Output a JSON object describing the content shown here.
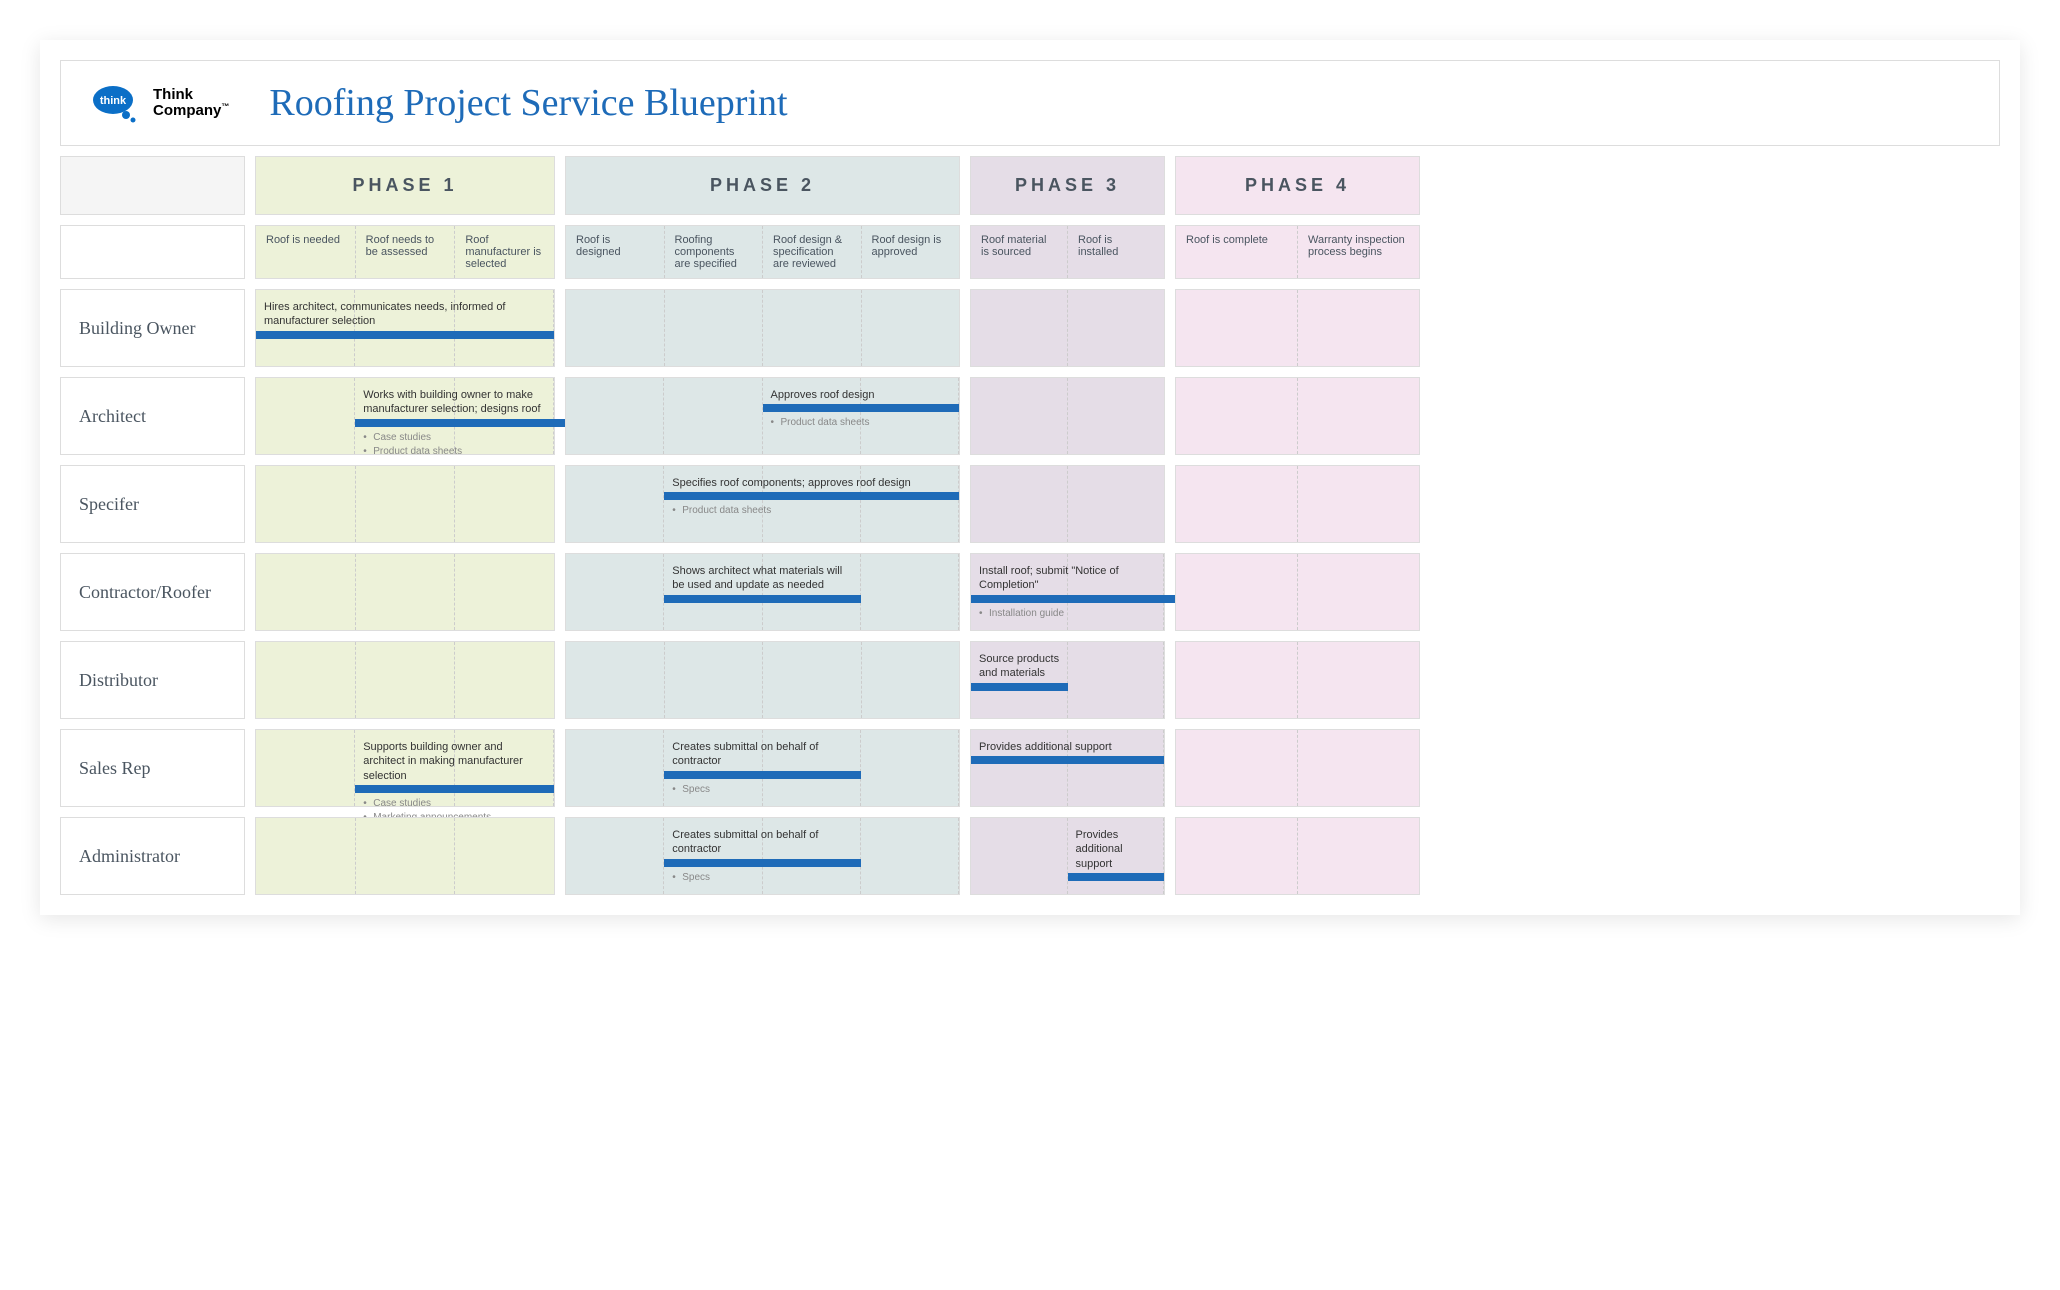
{
  "header": {
    "logo_text1": "Think",
    "logo_text2": "Company",
    "title": "Roofing Project Service Blueprint"
  },
  "phases": [
    {
      "id": "phase1",
      "label": "PHASE 1",
      "subs": [
        "Roof is needed",
        "Roof needs to be assessed",
        "Roof manufacturer is selected"
      ]
    },
    {
      "id": "phase2",
      "label": "PHASE 2",
      "subs": [
        "Roof is designed",
        "Roofing components are specified",
        "Roof design & specification are reviewed",
        "Roof design is approved"
      ]
    },
    {
      "id": "phase3",
      "label": "PHASE 3",
      "subs": [
        "Roof material is sourced",
        "Roof is installed"
      ]
    },
    {
      "id": "phase4",
      "label": "PHASE 4",
      "subs": [
        "Roof is complete",
        "Warranty inspection process begins"
      ]
    }
  ],
  "roles": [
    {
      "name": "Building Owner"
    },
    {
      "name": "Architect"
    },
    {
      "name": "Specifer"
    },
    {
      "name": "Contractor/Roofer"
    },
    {
      "name": "Distributor"
    },
    {
      "name": "Sales Rep"
    },
    {
      "name": "Administrator"
    }
  ],
  "tasks": {
    "building_owner_p1": {
      "text": "Hires architect, communicates needs, informed of manufacturer selection"
    },
    "architect_p1": {
      "text": "Works with building owner to make manufacturer selection; designs roof",
      "notes": [
        "Case studies",
        "Product data sheets"
      ]
    },
    "architect_p2": {
      "text": "Approves roof design",
      "notes": [
        "Product data sheets"
      ]
    },
    "specifier_p2": {
      "text": "Specifies roof components; approves roof design",
      "notes": [
        "Product data sheets"
      ]
    },
    "contractor_p2": {
      "text": "Shows architect what materials will be used and update as needed"
    },
    "contractor_p3": {
      "text": "Install roof; submit \"Notice of Completion\"",
      "notes": [
        "Installation guide"
      ]
    },
    "distributor_p3": {
      "text": "Source products and materials"
    },
    "salesrep_p1": {
      "text": "Supports building owner and architect in making manufacturer selection",
      "notes": [
        "Case studies",
        "Marketing announcements"
      ]
    },
    "salesrep_p2": {
      "text": "Creates submittal on behalf of contractor",
      "notes": [
        "Specs"
      ]
    },
    "salesrep_p3": {
      "text": "Provides additional support"
    },
    "admin_p2": {
      "text": "Creates submittal on behalf of contractor",
      "notes": [
        "Specs"
      ]
    },
    "admin_p3": {
      "text": "Provides additional support"
    }
  }
}
